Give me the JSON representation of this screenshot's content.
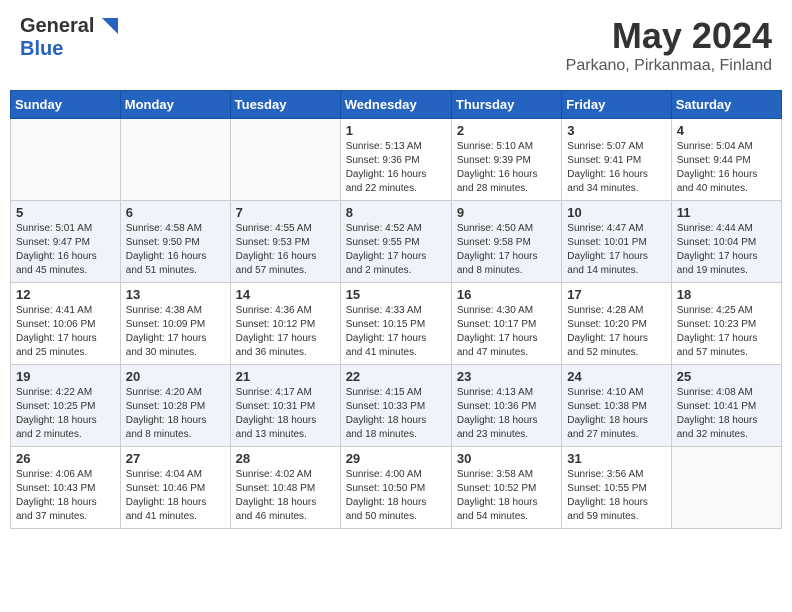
{
  "header": {
    "logo_general": "General",
    "logo_blue": "Blue",
    "month_title": "May 2024",
    "location": "Parkano, Pirkanmaa, Finland"
  },
  "days_of_week": [
    "Sunday",
    "Monday",
    "Tuesday",
    "Wednesday",
    "Thursday",
    "Friday",
    "Saturday"
  ],
  "weeks": [
    [
      {
        "day": "",
        "info": ""
      },
      {
        "day": "",
        "info": ""
      },
      {
        "day": "",
        "info": ""
      },
      {
        "day": "1",
        "info": "Sunrise: 5:13 AM\nSunset: 9:36 PM\nDaylight: 16 hours\nand 22 minutes."
      },
      {
        "day": "2",
        "info": "Sunrise: 5:10 AM\nSunset: 9:39 PM\nDaylight: 16 hours\nand 28 minutes."
      },
      {
        "day": "3",
        "info": "Sunrise: 5:07 AM\nSunset: 9:41 PM\nDaylight: 16 hours\nand 34 minutes."
      },
      {
        "day": "4",
        "info": "Sunrise: 5:04 AM\nSunset: 9:44 PM\nDaylight: 16 hours\nand 40 minutes."
      }
    ],
    [
      {
        "day": "5",
        "info": "Sunrise: 5:01 AM\nSunset: 9:47 PM\nDaylight: 16 hours\nand 45 minutes."
      },
      {
        "day": "6",
        "info": "Sunrise: 4:58 AM\nSunset: 9:50 PM\nDaylight: 16 hours\nand 51 minutes."
      },
      {
        "day": "7",
        "info": "Sunrise: 4:55 AM\nSunset: 9:53 PM\nDaylight: 16 hours\nand 57 minutes."
      },
      {
        "day": "8",
        "info": "Sunrise: 4:52 AM\nSunset: 9:55 PM\nDaylight: 17 hours\nand 2 minutes."
      },
      {
        "day": "9",
        "info": "Sunrise: 4:50 AM\nSunset: 9:58 PM\nDaylight: 17 hours\nand 8 minutes."
      },
      {
        "day": "10",
        "info": "Sunrise: 4:47 AM\nSunset: 10:01 PM\nDaylight: 17 hours\nand 14 minutes."
      },
      {
        "day": "11",
        "info": "Sunrise: 4:44 AM\nSunset: 10:04 PM\nDaylight: 17 hours\nand 19 minutes."
      }
    ],
    [
      {
        "day": "12",
        "info": "Sunrise: 4:41 AM\nSunset: 10:06 PM\nDaylight: 17 hours\nand 25 minutes."
      },
      {
        "day": "13",
        "info": "Sunrise: 4:38 AM\nSunset: 10:09 PM\nDaylight: 17 hours\nand 30 minutes."
      },
      {
        "day": "14",
        "info": "Sunrise: 4:36 AM\nSunset: 10:12 PM\nDaylight: 17 hours\nand 36 minutes."
      },
      {
        "day": "15",
        "info": "Sunrise: 4:33 AM\nSunset: 10:15 PM\nDaylight: 17 hours\nand 41 minutes."
      },
      {
        "day": "16",
        "info": "Sunrise: 4:30 AM\nSunset: 10:17 PM\nDaylight: 17 hours\nand 47 minutes."
      },
      {
        "day": "17",
        "info": "Sunrise: 4:28 AM\nSunset: 10:20 PM\nDaylight: 17 hours\nand 52 minutes."
      },
      {
        "day": "18",
        "info": "Sunrise: 4:25 AM\nSunset: 10:23 PM\nDaylight: 17 hours\nand 57 minutes."
      }
    ],
    [
      {
        "day": "19",
        "info": "Sunrise: 4:22 AM\nSunset: 10:25 PM\nDaylight: 18 hours\nand 2 minutes."
      },
      {
        "day": "20",
        "info": "Sunrise: 4:20 AM\nSunset: 10:28 PM\nDaylight: 18 hours\nand 8 minutes."
      },
      {
        "day": "21",
        "info": "Sunrise: 4:17 AM\nSunset: 10:31 PM\nDaylight: 18 hours\nand 13 minutes."
      },
      {
        "day": "22",
        "info": "Sunrise: 4:15 AM\nSunset: 10:33 PM\nDaylight: 18 hours\nand 18 minutes."
      },
      {
        "day": "23",
        "info": "Sunrise: 4:13 AM\nSunset: 10:36 PM\nDaylight: 18 hours\nand 23 minutes."
      },
      {
        "day": "24",
        "info": "Sunrise: 4:10 AM\nSunset: 10:38 PM\nDaylight: 18 hours\nand 27 minutes."
      },
      {
        "day": "25",
        "info": "Sunrise: 4:08 AM\nSunset: 10:41 PM\nDaylight: 18 hours\nand 32 minutes."
      }
    ],
    [
      {
        "day": "26",
        "info": "Sunrise: 4:06 AM\nSunset: 10:43 PM\nDaylight: 18 hours\nand 37 minutes."
      },
      {
        "day": "27",
        "info": "Sunrise: 4:04 AM\nSunset: 10:46 PM\nDaylight: 18 hours\nand 41 minutes."
      },
      {
        "day": "28",
        "info": "Sunrise: 4:02 AM\nSunset: 10:48 PM\nDaylight: 18 hours\nand 46 minutes."
      },
      {
        "day": "29",
        "info": "Sunrise: 4:00 AM\nSunset: 10:50 PM\nDaylight: 18 hours\nand 50 minutes."
      },
      {
        "day": "30",
        "info": "Sunrise: 3:58 AM\nSunset: 10:52 PM\nDaylight: 18 hours\nand 54 minutes."
      },
      {
        "day": "31",
        "info": "Sunrise: 3:56 AM\nSunset: 10:55 PM\nDaylight: 18 hours\nand 59 minutes."
      },
      {
        "day": "",
        "info": ""
      }
    ]
  ]
}
